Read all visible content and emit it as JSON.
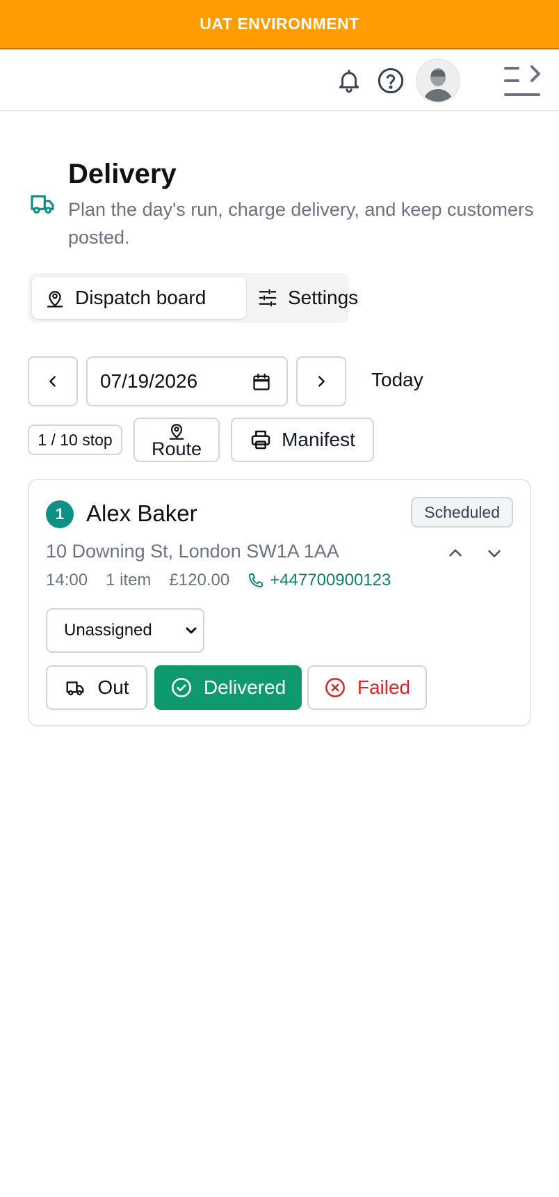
{
  "environment_banner": "UAT ENVIRONMENT",
  "header": {
    "icons": [
      "bell-icon",
      "help-icon",
      "avatar",
      "sidebar-toggle-icon"
    ]
  },
  "page": {
    "title": "Delivery",
    "subtitle": "Plan the day's run, charge delivery, and keep customers posted.",
    "icon": "truck-icon"
  },
  "tabs": [
    {
      "label": "Dispatch board",
      "icon": "map-pin-user-icon",
      "active": true
    },
    {
      "label": "Settings",
      "icon": "sliders-icon",
      "active": false
    }
  ],
  "date_nav": {
    "date_value": "07/19/2026",
    "today_label": "Today"
  },
  "toolbar": {
    "stop_count": "1 / 10 stop",
    "route_label": "Route",
    "manifest_label": "Manifest"
  },
  "stops": [
    {
      "number": "1",
      "name": "Alex Baker",
      "status": "Scheduled",
      "address": "10 Downing St, London SW1A 1AA",
      "time": "14:00",
      "items": "1 item",
      "amount": "£120.00",
      "phone": "+447700900123",
      "driver": "Unassigned",
      "actions": {
        "out": "Out",
        "delivered": "Delivered",
        "failed": "Failed"
      }
    }
  ],
  "colors": {
    "banner": "#ff9c00",
    "teal": "#0e9185",
    "delivered_green": "#0e9a6c",
    "failed_red": "#dc2626"
  }
}
